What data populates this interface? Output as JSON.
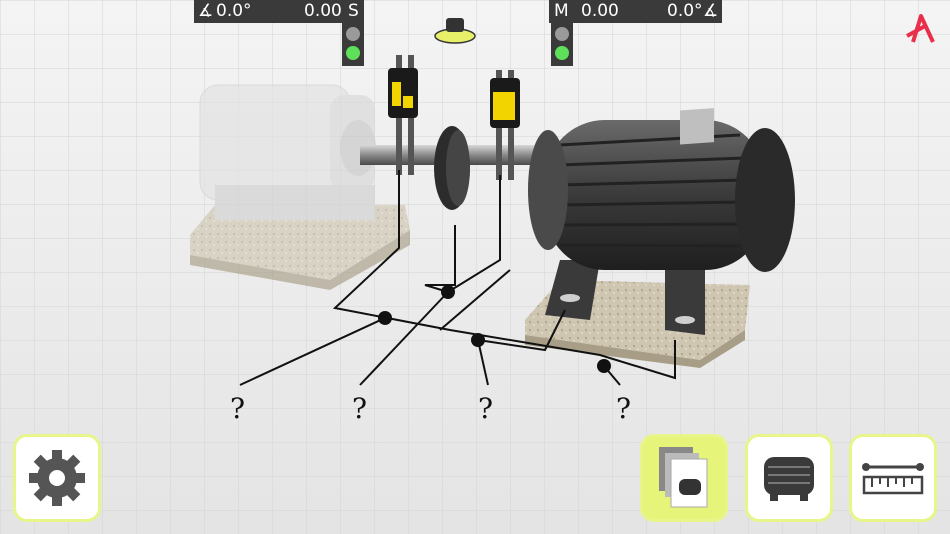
{
  "sensor_s": {
    "angle": "0.0°",
    "value": "0.00",
    "letter": "S"
  },
  "sensor_m": {
    "letter": "M",
    "value": "0.00",
    "angle": "0.0°"
  },
  "callouts": [
    "?",
    "?",
    "?",
    "?"
  ],
  "toolbar": {
    "settings_icon": "gear-icon",
    "machines_icon": "document-stack-machine-icon",
    "machine_icon": "motor-icon",
    "measure_icon": "ruler-distance-icon",
    "active_button": "machines"
  },
  "colors": {
    "accent": "#e6f57a",
    "hud": "#3a3a3a",
    "status_ok": "#5fe05a",
    "logo": "#e8304a"
  }
}
